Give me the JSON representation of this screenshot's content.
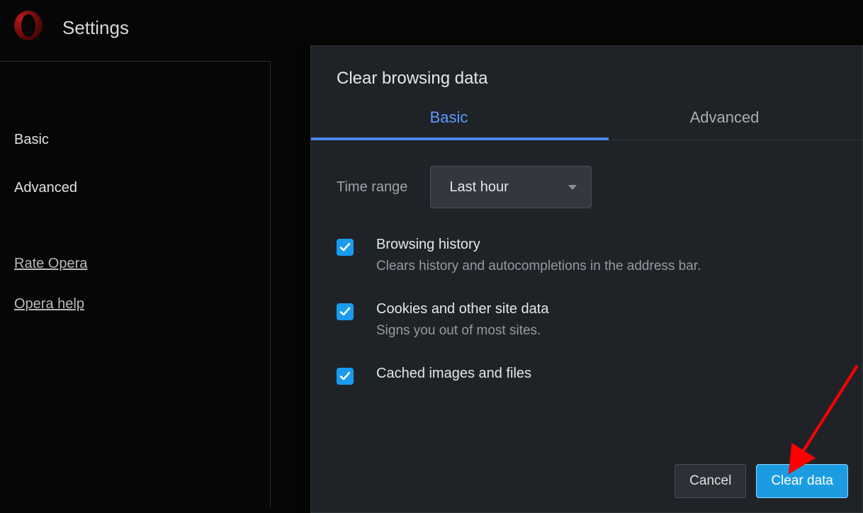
{
  "page": {
    "title": "Settings"
  },
  "sidebar": {
    "basic": "Basic",
    "advanced": "Advanced",
    "rate": "Rate Opera",
    "help": "Opera help"
  },
  "dialog": {
    "title": "Clear browsing data",
    "tabs": {
      "basic": "Basic",
      "advanced": "Advanced"
    },
    "time_label": "Time range",
    "time_value": "Last hour",
    "options": [
      {
        "title": "Browsing history",
        "desc": "Clears history and autocompletions in the address bar."
      },
      {
        "title": "Cookies and other site data",
        "desc": "Signs you out of most sites."
      },
      {
        "title": "Cached images and files",
        "desc": ""
      }
    ],
    "cancel": "Cancel",
    "clear": "Clear data"
  }
}
